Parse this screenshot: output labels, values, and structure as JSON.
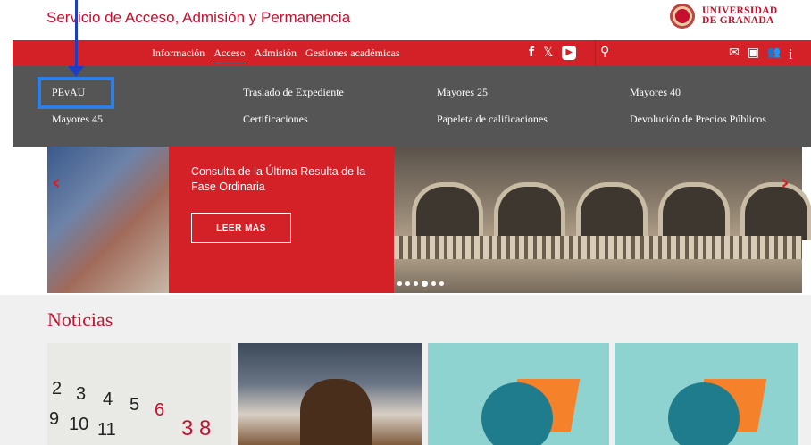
{
  "header": {
    "site_title": "Servicio de Acceso, Admisión y Permanencia",
    "logo_line1": "UNIVERSIDAD",
    "logo_line2": "DE GRANADA"
  },
  "nav": {
    "items": [
      {
        "label": "Información",
        "active": false
      },
      {
        "label": "Acceso",
        "active": true
      },
      {
        "label": "Admisión",
        "active": false
      },
      {
        "label": "Gestiones académicas",
        "active": false
      }
    ],
    "social": {
      "facebook": "f",
      "x": "𝕏",
      "youtube": "▶"
    },
    "search_icon": "⚲",
    "right_icons": {
      "mail": "✉",
      "id_card": "▣",
      "users": "👥",
      "info": "i"
    }
  },
  "dropdown": {
    "links": [
      [
        "PEvAU",
        "Traslado de Expediente",
        "Mayores 25",
        "Mayores 40"
      ],
      [
        "Mayores 45",
        "Certificaciones",
        "Papeleta de calificaciones",
        "Devolución de Precios Públicos"
      ]
    ]
  },
  "hero": {
    "title": "Consulta de la Última Resulta de la Fase Ordinaria",
    "button": "LEER MÁS",
    "prev": "‹",
    "next": "›",
    "slide_count": 6,
    "active_slide": 3
  },
  "news": {
    "heading": "Noticias",
    "calendar_numbers": [
      "2",
      "3",
      "4",
      "5",
      "6",
      "9",
      "10",
      "11",
      "3",
      "8"
    ]
  },
  "colors": {
    "brand_red": "#d42127",
    "dropdown_bg": "#555555",
    "annotation_blue": "#2d7fe6"
  }
}
